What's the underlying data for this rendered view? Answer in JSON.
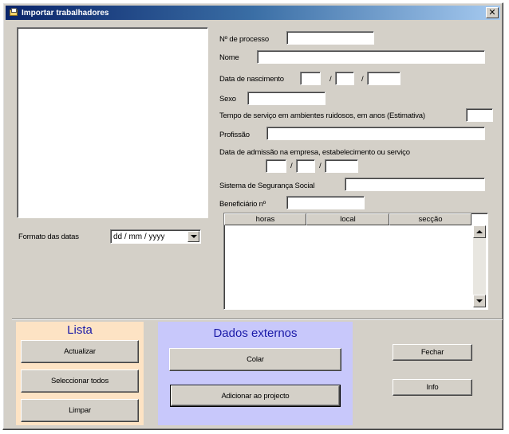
{
  "window": {
    "title": "Importar trabalhadores",
    "close_glyph": "✕"
  },
  "colors": {
    "lista_panel": "#fde3c4",
    "dados_panel": "#c8c8fb",
    "lista_title": "#1a1aa8",
    "dados_title": "#1a1aa8"
  },
  "form": {
    "processo_label": "Nº de processo",
    "processo_value": "",
    "nome_label": "Nome",
    "nome_value": "",
    "nascimento_label": "Data de nascimento",
    "date_sep": "/",
    "sexo_label": "Sexo",
    "sexo_value": "",
    "tempo_label": "Tempo de serviço em ambientes ruidosos, em anos (Estimativa)",
    "tempo_value": "",
    "profissao_label": "Profissão",
    "profissao_value": "",
    "admissao_label": "Data de admissão na empresa, estabelecimento ou serviço",
    "seguranca_label": "Sistema de Segurança Social",
    "seguranca_value": "",
    "beneficiario_label": "Beneficiário nº",
    "beneficiario_value": ""
  },
  "formato": {
    "label": "Formato das datas",
    "selected": "dd / mm / yyyy"
  },
  "grid": {
    "columns": [
      "horas",
      "local",
      "secção"
    ]
  },
  "lista": {
    "title": "Lista",
    "actualizar": "Actualizar",
    "seleccionar": "Seleccionar todos",
    "limpar": "Limpar"
  },
  "dados": {
    "title": "Dados externos",
    "colar": "Colar",
    "adicionar": "Adicionar ao projecto"
  },
  "actions": {
    "fechar": "Fechar",
    "info": "Info"
  },
  "icons": {
    "title": "folder-icon",
    "close": "close-icon",
    "dropdown": "chevron-down-icon",
    "scroll_up": "arrow-up-icon",
    "scroll_down": "arrow-down-icon"
  }
}
